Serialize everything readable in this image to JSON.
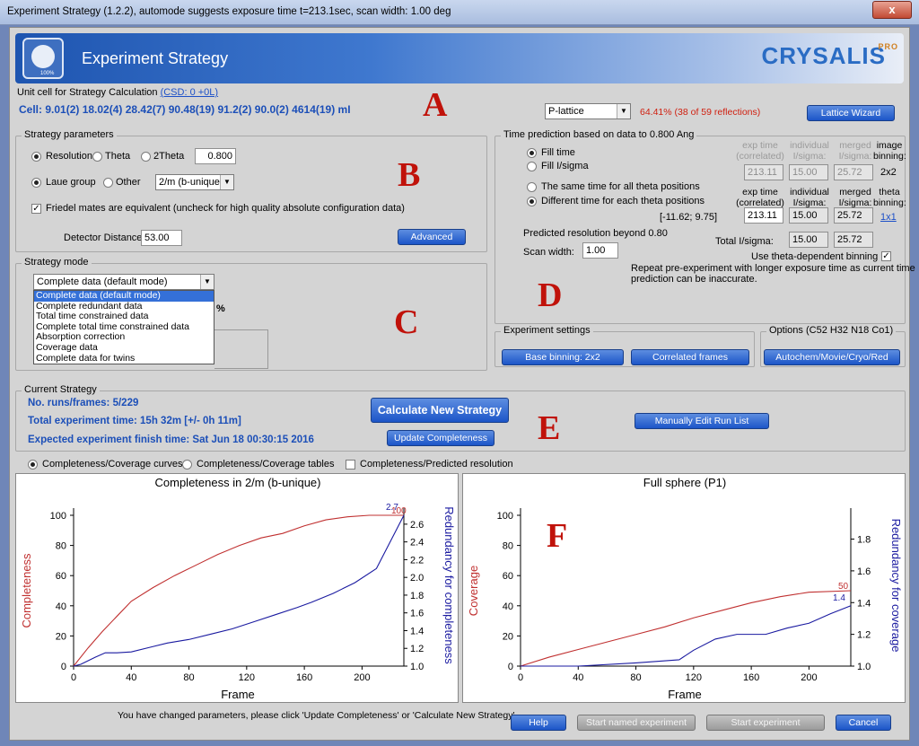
{
  "window": {
    "title": "Experiment Strategy  (1.2.2), automode suggests exposure time t=213.1sec, scan width: 1.00 deg",
    "close": "x"
  },
  "header": {
    "title": "Experiment Strategy",
    "brand": "CRYSALIS",
    "brand_pro": "PRO",
    "icon_label": "100%"
  },
  "unitcell": {
    "label": "Unit cell for Strategy Calculation",
    "csd_link": "(CSD: 0 +0L)",
    "cell": "Cell: 9.01(2) 18.02(4) 28.42(7) 90.48(19) 91.2(2) 90.0(2) 4614(19)  mI",
    "lattice_select": "P-lattice",
    "percent": "64.41% (38 of 59 reflections)",
    "wizard_button": "Lattice Wizard"
  },
  "letters": {
    "a": "A",
    "b": "B",
    "c": "C",
    "d": "D",
    "e": "E",
    "f": "F"
  },
  "strategy": {
    "label": "Strategy parameters",
    "resolution": "Resolution",
    "theta": "Theta",
    "twotheta": "2Theta",
    "res_value": "0.800",
    "laue": "Laue group",
    "other": "Other",
    "laue_select": "2/m (b-unique)",
    "friedel": "Friedel mates are equivalent (uncheck for high quality absolute configuration data)",
    "detector_label": "Detector Distance",
    "detector_value": "53.00",
    "advanced": "Advanced"
  },
  "mode": {
    "label": "Strategy mode",
    "selected": "Complete data (default mode)",
    "options": [
      "Complete data (default mode)",
      "Complete redundant data",
      "Total time constrained data",
      "Complete total time constrained data",
      "Absorption correction",
      "Coverage data",
      "Complete data for twins"
    ],
    "percent": "%"
  },
  "time": {
    "label": "Time prediction based on data to 0.800 Ang",
    "fill_time": "Fill time",
    "fill_isigma": "Fill I/sigma",
    "same_time": "The same time for all theta positions",
    "diff_time": "Different time for each theta positions",
    "range": "[-11.62; 9.75]",
    "h1": "exp time\n(correlated)",
    "h2": "individual\nI/sigma:",
    "h3": "merged\nI/sigma:",
    "h4": "image\nbinning:",
    "r1": [
      "213.11",
      "15.00",
      "25.72"
    ],
    "r1_bin": "2x2",
    "r2": [
      "213.11",
      "15.00",
      "25.72"
    ],
    "r2_bin": "1x1",
    "theta_bin": "theta\nbinning:",
    "pred_res": "Predicted resolution beyond 0.80",
    "scan_label": "Scan width:",
    "scan_value": "1.00",
    "total_label": "Total I/sigma:",
    "total": [
      "15.00",
      "25.72"
    ],
    "use_theta": "Use theta-dependent binning",
    "repeat": "Repeat pre-experiment with longer exposure time as current time\nprediction can be inaccurate."
  },
  "exp_settings": {
    "label": "Experiment settings",
    "base": "Base binning: 2x2",
    "correlated": "Correlated frames"
  },
  "options": {
    "label": "Options (C52 H32 N18 Co1)",
    "autochem": "Autochem/Movie/Cryo/Red"
  },
  "current": {
    "label": "Current Strategy",
    "runs": "No. runs/frames: 5/229",
    "total": "Total experiment time: 15h 32m [+/- 0h 11m]",
    "finish": "Expected experiment finish time: Sat Jun 18 00:30:15 2016",
    "calc": "Calculate New Strategy",
    "update": "Update Completeness",
    "manual": "Manually Edit Run List"
  },
  "curves": {
    "a": "Completeness/Coverage curves",
    "b": "Completeness/Coverage tables",
    "c": "Completeness/Predicted resolution"
  },
  "footer": {
    "message": "You have changed parameters, please click 'Update Completeness' or 'Calculate New Strategy'",
    "help": "Help",
    "start_named": "Start named experiment",
    "start": "Start experiment",
    "cancel": "Cancel"
  },
  "colors": {
    "red": "#c03030",
    "blue": "#1a1aa0"
  },
  "chart_data": [
    {
      "type": "line",
      "title": "Completeness in 2/m (b-unique)",
      "xlabel": "Frame",
      "ylabel": "Completeness",
      "y2label": "Redundancy for completeness",
      "xlim": [
        0,
        229
      ],
      "ylim": [
        0,
        100
      ],
      "y2lim": [
        1.0,
        2.7
      ],
      "xticks": [
        "0",
        "40",
        "80",
        "120",
        "160",
        "200"
      ],
      "yticks": [
        "0",
        "20",
        "40",
        "60",
        "80",
        "100"
      ],
      "y2ticks": [
        "1.0",
        "1.2",
        "1.4",
        "1.6",
        "1.8",
        "2.0",
        "2.2",
        "2.4",
        "2.6"
      ],
      "end_labels": [
        "100",
        "2.7"
      ],
      "series": [
        {
          "x": [
            0,
            10,
            20,
            30,
            40,
            55,
            70,
            85,
            100,
            115,
            130,
            145,
            160,
            175,
            190,
            205,
            229
          ],
          "y": [
            0,
            12,
            23,
            33,
            43,
            52,
            60,
            67,
            74,
            80,
            85,
            88,
            93,
            97,
            99,
            100,
            100
          ]
        },
        {
          "x": [
            0,
            5,
            15,
            22,
            30,
            40,
            55,
            65,
            80,
            95,
            110,
            125,
            140,
            155,
            165,
            180,
            195,
            210,
            229
          ],
          "y2": [
            1.0,
            1.02,
            1.1,
            1.15,
            1.15,
            1.16,
            1.22,
            1.26,
            1.3,
            1.36,
            1.42,
            1.5,
            1.58,
            1.66,
            1.72,
            1.82,
            1.94,
            2.1,
            2.7
          ]
        }
      ]
    },
    {
      "type": "line",
      "title": "Full sphere (P1)",
      "xlabel": "Frame",
      "ylabel": "Coverage",
      "y2label": "Redundancy for coverage",
      "xlim": [
        0,
        229
      ],
      "ylim": [
        0,
        100
      ],
      "y2lim": [
        1.0,
        1.95
      ],
      "xticks": [
        "0",
        "40",
        "80",
        "120",
        "160",
        "200"
      ],
      "yticks": [
        "0",
        "20",
        "40",
        "60",
        "80",
        "100"
      ],
      "y2ticks": [
        "1.0",
        "1.2",
        "1.4",
        "1.6",
        "1.8"
      ],
      "end_labels": [
        "50",
        "1.4"
      ],
      "series": [
        {
          "x": [
            0,
            20,
            40,
            60,
            80,
            100,
            120,
            140,
            160,
            180,
            200,
            229
          ],
          "y": [
            0,
            6,
            11,
            16,
            21,
            26,
            32,
            37,
            42,
            46,
            49,
            50
          ]
        },
        {
          "x": [
            0,
            40,
            80,
            110,
            120,
            135,
            150,
            170,
            185,
            200,
            215,
            229
          ],
          "y2": [
            1.0,
            1.0,
            1.02,
            1.04,
            1.1,
            1.17,
            1.2,
            1.2,
            1.24,
            1.27,
            1.33,
            1.38
          ]
        }
      ]
    }
  ]
}
